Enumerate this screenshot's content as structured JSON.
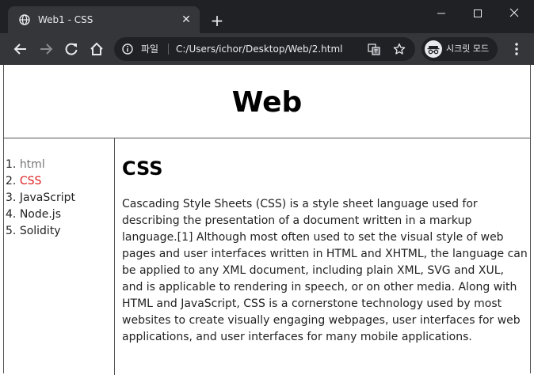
{
  "browser": {
    "tab_title": "Web1 - CSS",
    "scheme_label": "파일",
    "url": "C:/Users/ichor/Desktop/Web/2.html",
    "incognito_label": "시크릿 모드",
    "colors": {
      "frame": "#202124",
      "toolbar": "#35363a",
      "text": "#e8eaed"
    }
  },
  "page": {
    "title": "Web",
    "nav": [
      {
        "number": "1.",
        "label": "html",
        "state": "visited"
      },
      {
        "number": "2.",
        "label": "CSS",
        "state": "active"
      },
      {
        "number": "3.",
        "label": "JavaScript",
        "state": "normal"
      },
      {
        "number": "4.",
        "label": "Node.js",
        "state": "normal"
      },
      {
        "number": "5.",
        "label": "Solidity",
        "state": "normal"
      }
    ],
    "article_title": "CSS",
    "article_body": "Cascading Style Sheets (CSS) is a style sheet language used for describing the presentation of a document written in a markup language.[1] Although most often used to set the visual style of web pages and user interfaces written in HTML and XHTML, the language can be applied to any XML document, including plain XML, SVG and XUL, and is applicable to rendering in speech, or on other media. Along with HTML and JavaScript, CSS is a cornerstone technology used by most websites to create visually engaging webpages, user interfaces for web applications, and user interfaces for many mobile applications.",
    "colors": {
      "active_link": "#e02020",
      "visited_link": "#777777"
    }
  }
}
